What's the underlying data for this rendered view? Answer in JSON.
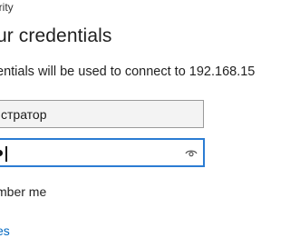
{
  "dialog": {
    "caption": "urity",
    "title": "ur credentials",
    "description": "entials will be used to connect to 192.168.15",
    "username_value": "стратор",
    "remember_label": "mber me",
    "more_choices_label": "es"
  }
}
